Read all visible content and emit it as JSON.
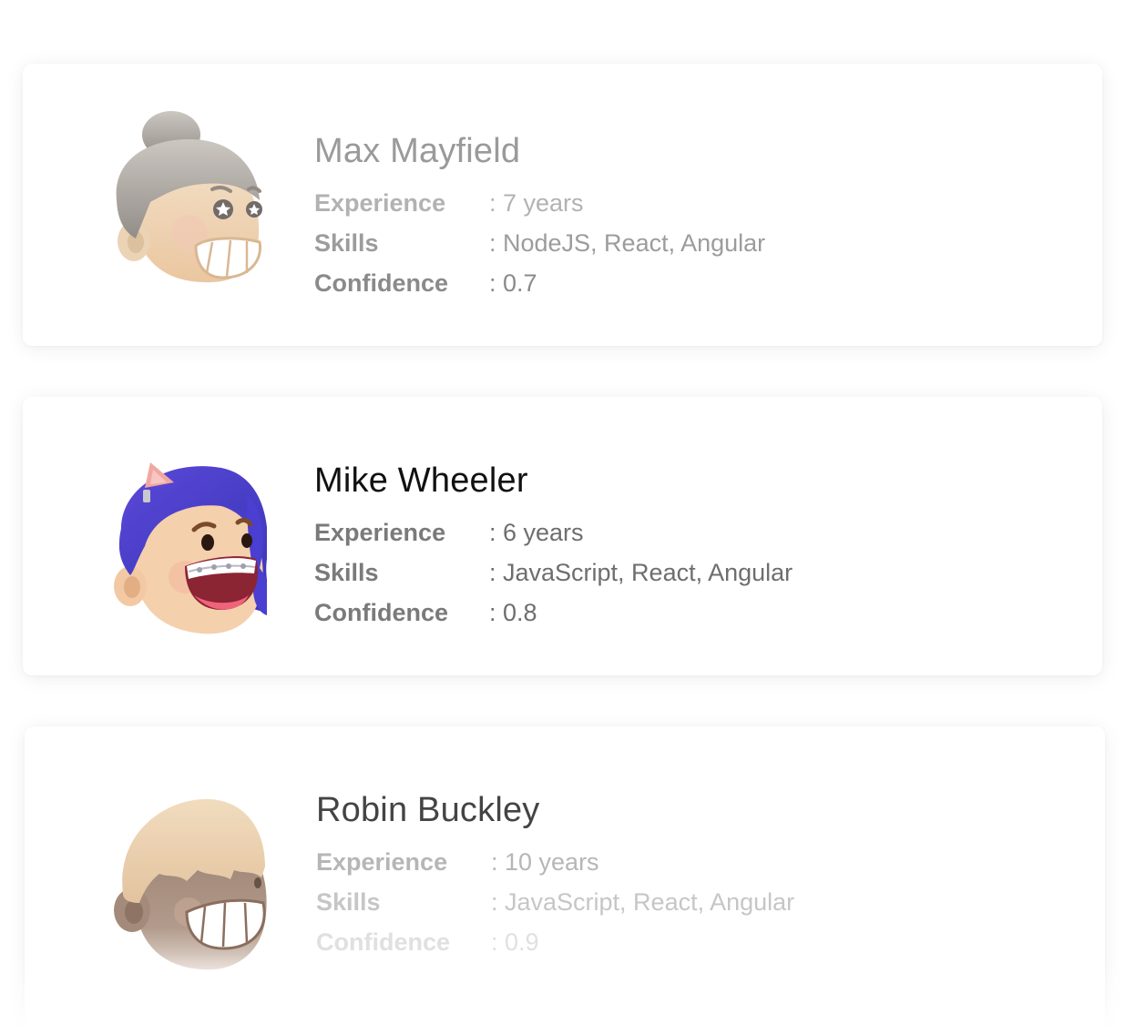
{
  "labels": {
    "experience": "Experience",
    "skills": "Skills",
    "confidence": "Confidence"
  },
  "candidates": [
    {
      "name": "Max Mayfield",
      "experience": ": 7 years",
      "skills": ": NodeJS, React, Angular",
      "confidence": ": 0.7",
      "avatar_icon": "avatar-bun-hair-grin-icon"
    },
    {
      "name": "Mike Wheeler",
      "experience": ": 6 years",
      "skills": ": JavaScript, React, Angular",
      "confidence": ": 0.8",
      "avatar_icon": "avatar-purple-hair-braces-icon"
    },
    {
      "name": "Robin Buckley",
      "experience": ": 10 years",
      "skills": ": JavaScript, React, Angular",
      "confidence": ": 0.9",
      "avatar_icon": "avatar-bangs-grin-icon"
    }
  ]
}
